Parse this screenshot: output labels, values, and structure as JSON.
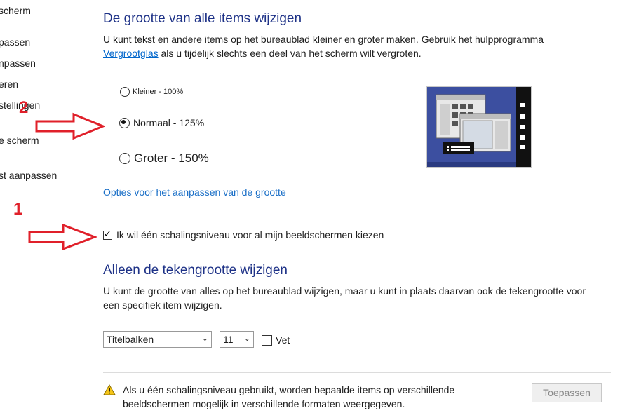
{
  "sidebar": {
    "items": [
      "scherm",
      "passen",
      "npassen",
      "eren",
      "stellingen",
      "e scherm",
      "st aanpassen"
    ]
  },
  "section1": {
    "title": "De grootte van alle items wijzigen",
    "desc_before": "U kunt tekst en andere items op het bureaublad kleiner en groter maken. Gebruik het hulpprogramma ",
    "desc_link": "Vergrootglas",
    "desc_after": " als u tijdelijk slechts een deel van het scherm wilt vergroten.",
    "options": [
      {
        "label": "Kleiner - 100%",
        "checked": false
      },
      {
        "label": "Normaal - 125%",
        "checked": true
      },
      {
        "label": "Groter - 150%",
        "checked": false
      }
    ],
    "custom_link": "Opties voor het aanpassen van de grootte",
    "checkbox_label": "Ik wil één schalingsniveau voor al mijn beeldschermen kiezen",
    "checkbox_checked": true
  },
  "section2": {
    "title": "Alleen de tekengrootte wijzigen",
    "desc": "U kunt de grootte van alles op het bureaublad wijzigen, maar u kunt in plaats daarvan ook de tekengrootte voor een specifiek item wijzigen.",
    "item_select": "Titelbalken",
    "size_select": "11",
    "bold_label": "Vet",
    "bold_checked": false
  },
  "footer": {
    "warning": "Als u één schalingsniveau gebruikt, worden bepaalde items op verschillende beeldschermen mogelijk in verschillende formaten weergegeven.",
    "apply_label": "Toepassen"
  },
  "annotations": {
    "num1": "1",
    "num2": "2",
    "color": "#e0202a"
  },
  "colors": {
    "heading": "#1e3287",
    "link": "#1a6fc7",
    "preview_blue": "#3c4fa0"
  }
}
